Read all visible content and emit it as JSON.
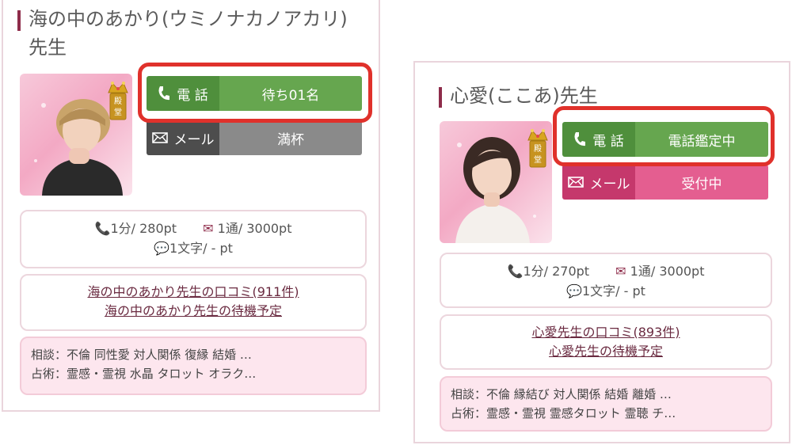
{
  "colors": {
    "tel_green": "#66a64f",
    "highlight_red": "#e0312b",
    "mail_pink": "#e45e90",
    "title_bar": "#8e2c4a"
  },
  "cards": [
    {
      "name": "海の中のあかり(ウミノナカノアカリ)先生",
      "badge": "殿堂",
      "tel_label": "電 話",
      "tel_status": "待ち01名",
      "mail_label": "メール",
      "mail_status": "満杯",
      "price_tel": "1分/ 280pt",
      "price_mail": "1通/ 3000pt",
      "price_chat": "1文字/ - pt",
      "review_link": "海の中のあかり先生の口コミ(911件)",
      "schedule_link": "海の中のあかり先生の待機予定",
      "consult": "相談：不倫 同性愛 対人関係 復縁 結婚 …",
      "divination": "占術：霊感・霊視 水晶 タロット オラク…"
    },
    {
      "name": "心愛(ここあ)先生",
      "badge": "殿堂",
      "tel_label": "電 話",
      "tel_status": "電話鑑定中",
      "mail_label": "メール",
      "mail_status": "受付中",
      "price_tel": "1分/ 270pt",
      "price_mail": "1通/ 3000pt",
      "price_chat": "1文字/ - pt",
      "review_link": "心愛先生の口コミ(893件)",
      "schedule_link": "心愛先生の待機予定",
      "consult": "相談：不倫 縁結び 対人関係 結婚 離婚 …",
      "divination": "占術：霊感・霊視 霊感タロット 霊聴 チ…"
    }
  ]
}
